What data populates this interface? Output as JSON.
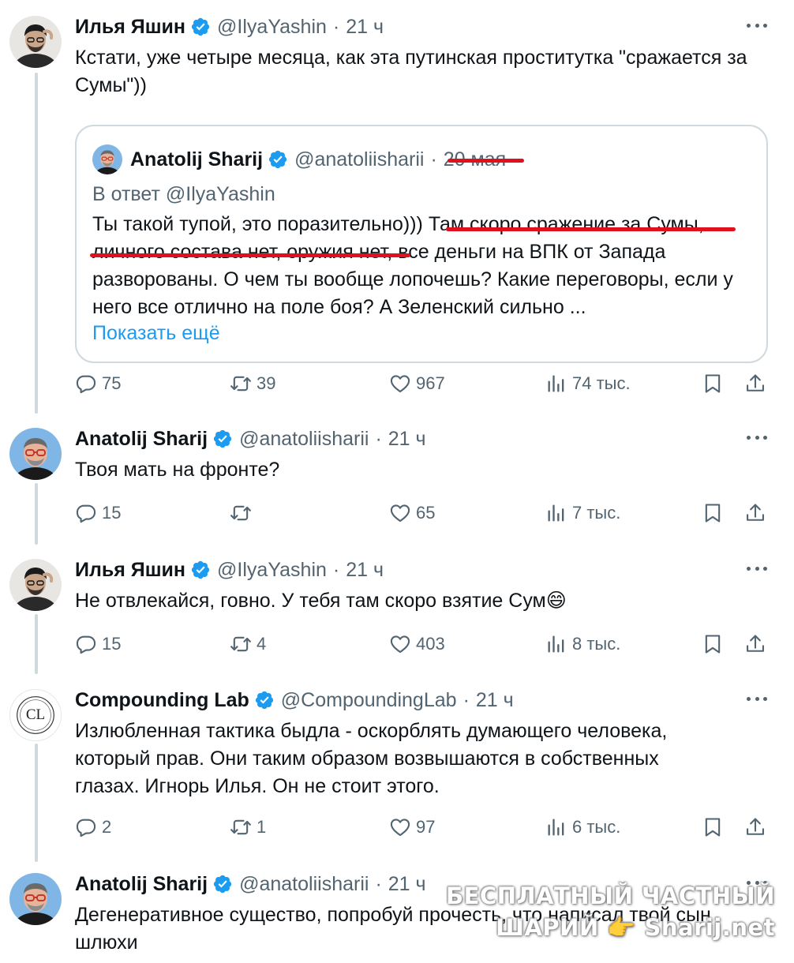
{
  "tweets": [
    {
      "author": "Илья Яшин",
      "handle": "@IlyaYashin",
      "dot": "·",
      "time": "21 ч",
      "text": "Кстати, уже четыре месяца, как эта путинская проститутка \"сражается за Сумы\"))",
      "quote": {
        "author": "Anatolij Sharij",
        "handle": "@anatoliisharii",
        "dot": "·",
        "time": "20 мая",
        "reply_to": "В ответ @IlyaYashin",
        "text": "Ты такой тупой, это поразительно))) Там скоро сражение за Сумы, личного состава нет, оружия нет, все деньги на ВПК от Запада разворованы. О чем ты вообще лопочешь?  Какие переговоры, если у него все отлично на поле боя? А Зеленский сильно ...",
        "show_more": "Показать ещё"
      },
      "stats": {
        "replies": "75",
        "retweets": "39",
        "likes": "967",
        "views": "74 тыс."
      }
    },
    {
      "author": "Anatolij Sharij",
      "handle": "@anatoliisharii",
      "dot": "·",
      "time": "21 ч",
      "text": "Твоя мать на фронте?",
      "stats": {
        "replies": "15",
        "retweets": "",
        "likes": "65",
        "views": "7 тыс."
      }
    },
    {
      "author": "Илья Яшин",
      "handle": "@IlyaYashin",
      "dot": "·",
      "time": "21 ч",
      "text": "Не отвлекайся, говно. У тебя там скоро взятие Сум😄",
      "stats": {
        "replies": "15",
        "retweets": "4",
        "likes": "403",
        "views": "8 тыс."
      }
    },
    {
      "author": "Compounding Lab",
      "handle": "@CompoundingLab",
      "dot": "·",
      "time": "21 ч",
      "avatar_text": "CL",
      "text": "Излюбленная тактика быдла - оскорблять думающего человека, который прав. Они таким образом возвышаются в собственных глазах. Игнорь Илья. Он не стоит этого.",
      "stats": {
        "replies": "2",
        "retweets": "1",
        "likes": "97",
        "views": "6 тыс."
      }
    },
    {
      "author": "Anatolij Sharij",
      "handle": "@anatoliisharii",
      "dot": "·",
      "time": "21 ч",
      "text": "Дегенеративное существо, попробуй прочесть, что написал твой сын шлюхи"
    }
  ],
  "watermark": {
    "line1": "БЕСПЛАТНЫЙ ЧАСТНЫЙ",
    "line2": "ШАРИЙ 👉 Sharij.net"
  },
  "colors": {
    "verified": "#1d9bf0",
    "link": "#1d9bf0",
    "muted": "#536471",
    "annotation": "#e0101f"
  },
  "icons": [
    "verified-badge-icon",
    "more-icon",
    "reply-icon",
    "retweet-icon",
    "like-icon",
    "views-icon",
    "bookmark-icon",
    "share-icon"
  ]
}
